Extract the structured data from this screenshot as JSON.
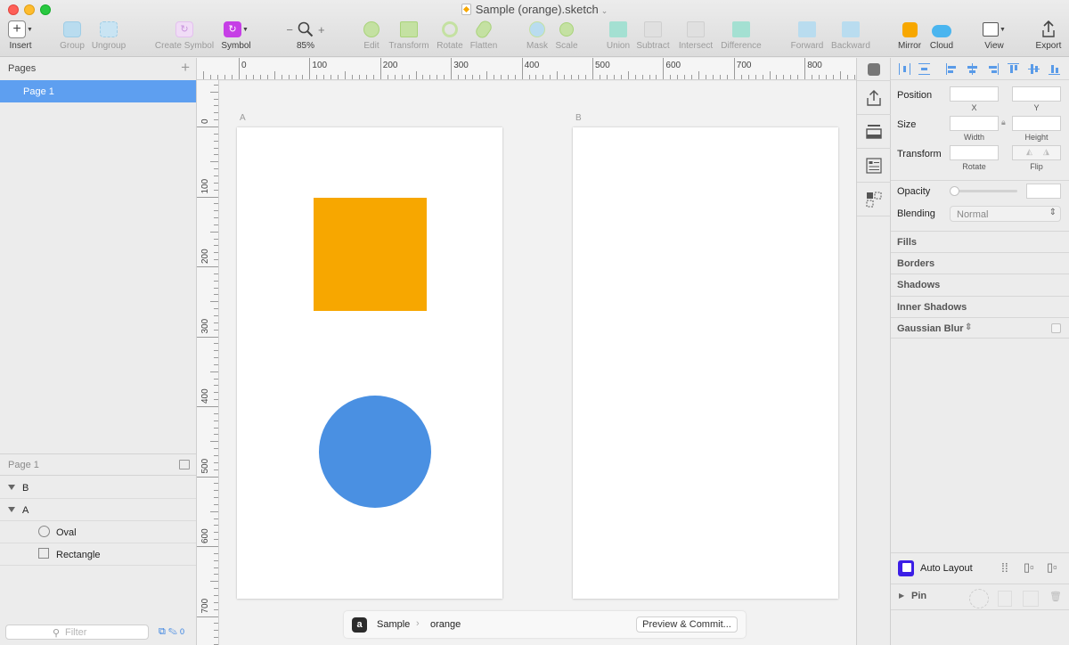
{
  "window": {
    "title": "Sample (orange).sketch"
  },
  "toolbar": {
    "insert": "Insert",
    "group": "Group",
    "ungroup": "Ungroup",
    "create_symbol": "Create Symbol",
    "symbol": "Symbol",
    "zoom_minus": "−",
    "zoom_plus": "+",
    "zoom_value": "85%",
    "edit": "Edit",
    "transform": "Transform",
    "rotate": "Rotate",
    "flatten": "Flatten",
    "mask": "Mask",
    "scale": "Scale",
    "union": "Union",
    "subtract": "Subtract",
    "intersect": "Intersect",
    "difference": "Difference",
    "forward": "Forward",
    "backward": "Backward",
    "mirror": "Mirror",
    "cloud": "Cloud",
    "view": "View",
    "export": "Export"
  },
  "pages_panel": {
    "title": "Pages",
    "add": "+",
    "pages": [
      "Page 1"
    ]
  },
  "layers_panel": {
    "title": "Page 1",
    "layers": [
      {
        "name": "B",
        "type": "artboard"
      },
      {
        "name": "A",
        "type": "artboard"
      },
      {
        "name": "Oval",
        "type": "oval"
      },
      {
        "name": "Rectangle",
        "type": "rectangle"
      }
    ],
    "filter_placeholder": "Filter",
    "filter_count": "0"
  },
  "rulers": {
    "horizontal": [
      "0",
      "100",
      "200",
      "300",
      "400",
      "500",
      "600",
      "700",
      "800"
    ],
    "vertical": [
      "0",
      "100",
      "200",
      "300",
      "400",
      "500",
      "600",
      "700"
    ]
  },
  "canvas": {
    "artboards": [
      {
        "name": "A"
      },
      {
        "name": "B"
      }
    ],
    "shapes": [
      {
        "name": "Rectangle",
        "color": "#F7A700"
      },
      {
        "name": "Oval",
        "color": "#4A90E2"
      }
    ]
  },
  "bottom_bar": {
    "project": "Sample",
    "separator": "›",
    "branch": "orange",
    "button": "Preview & Commit..."
  },
  "inspector": {
    "position": "Position",
    "x": "X",
    "y": "Y",
    "size": "Size",
    "width": "Width",
    "height": "Height",
    "transform": "Transform",
    "rotate": "Rotate",
    "flip": "Flip",
    "opacity": "Opacity",
    "blending": "Blending",
    "blending_value": "Normal",
    "sections": [
      "Fills",
      "Borders",
      "Shadows",
      "Inner Shadows",
      "Gaussian Blur"
    ],
    "auto_layout": "Auto Layout",
    "pin": "Pin"
  },
  "colors": {
    "accent": "#5E9FF0",
    "orange": "#F7A700",
    "blue": "#4A90E2",
    "symbol_purple": "#C63FE6"
  }
}
